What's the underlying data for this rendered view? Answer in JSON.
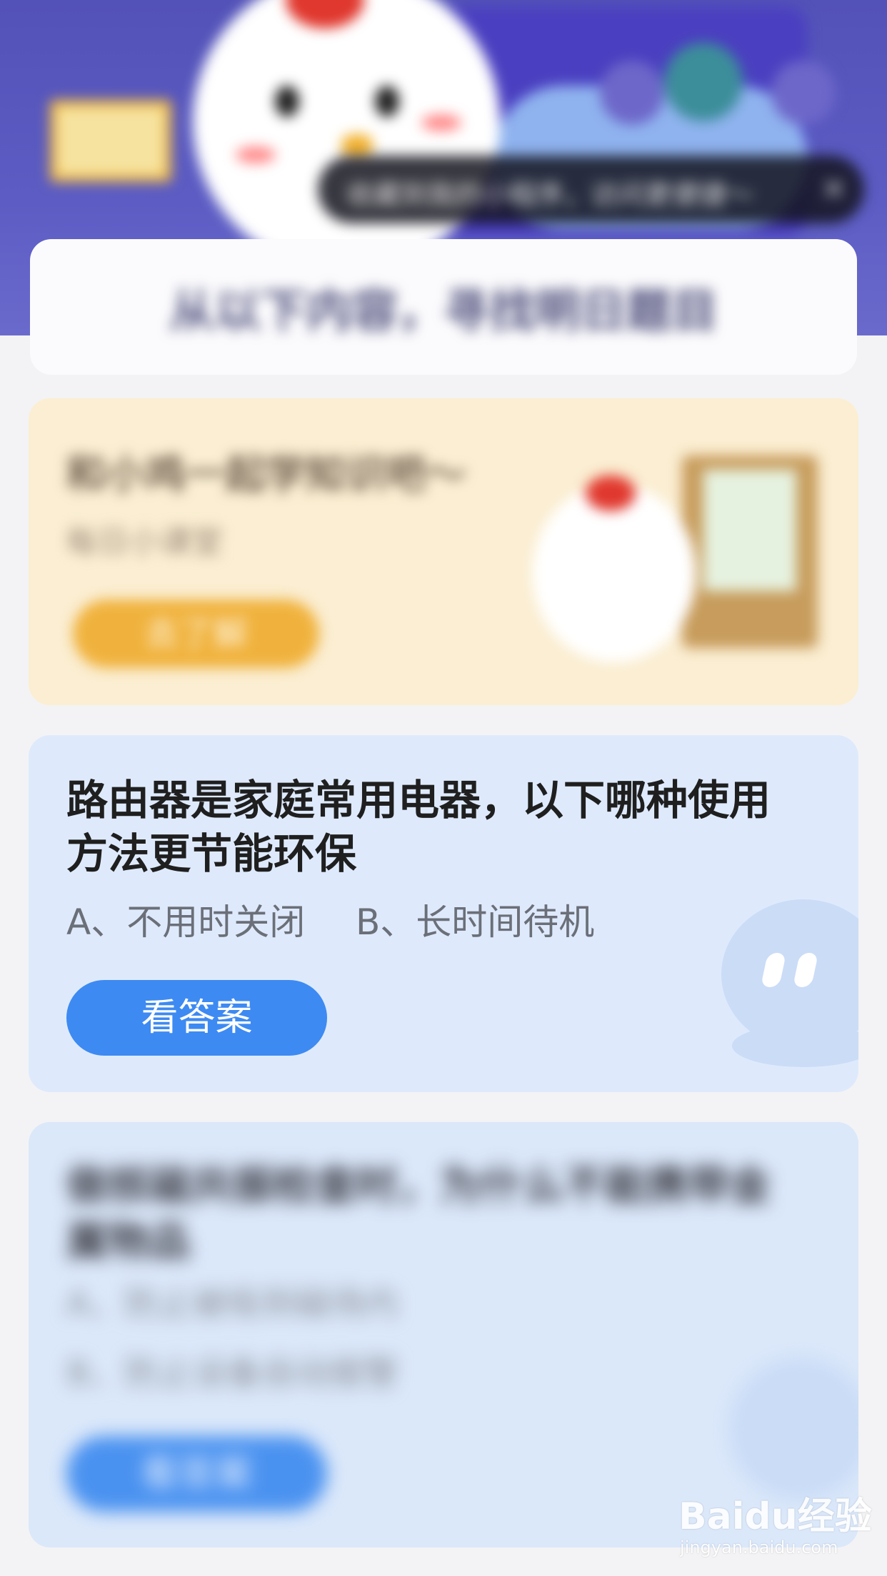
{
  "banner": {
    "tooltip_text": "收藏到我的小程序，访问更便捷～",
    "tooltip_close": "×",
    "heading": "从以下内容，寻找明日题目"
  },
  "learn_card": {
    "title": "和小鸡一起学知识吧～",
    "subtitle": "每日小课堂",
    "button_label": "去了解"
  },
  "questions": [
    {
      "title": "路由器是家庭常用电器，以下哪种使用方法更节能环保",
      "option_a": "A、不用时关闭",
      "option_b": "B、长时间待机",
      "button_label": "看答案"
    },
    {
      "title": "做核磁共振检查时，为什么不能携带金属物品",
      "option_a": "A、防止被吸到磁场内",
      "option_b": "B、防止设备自动报警",
      "button_label": "看答案"
    }
  ],
  "watermark": {
    "logo": "Baidu经验",
    "url": "jingyan.baidu.com"
  },
  "colors": {
    "banner_purple": "#5352b8",
    "question_card_bg": "#deeafc",
    "primary_button": "#3d8af2",
    "learn_card_bg": "#fbeed2",
    "learn_button": "#f0b23d"
  }
}
